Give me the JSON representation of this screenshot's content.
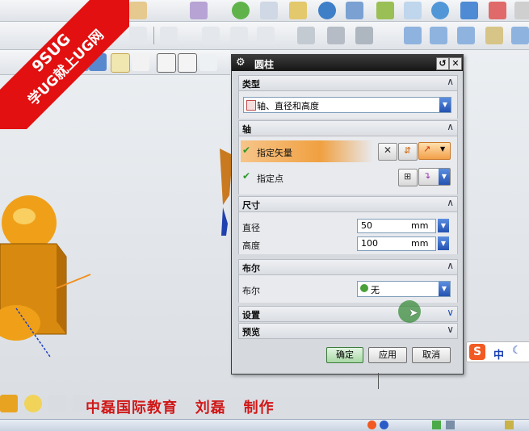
{
  "watermark": {
    "line1": "9SUG",
    "line2": "学UG就上UG网"
  },
  "dialog": {
    "title": "圆柱",
    "sections": {
      "type": {
        "label": "类型",
        "value": "轴、直径和高度"
      },
      "axis": {
        "label": "轴",
        "specify_vector": "指定矢量",
        "specify_point": "指定点"
      },
      "dimensions": {
        "label": "尺寸",
        "diameter_label": "直径",
        "diameter_value": "50",
        "diameter_unit": "mm",
        "height_label": "高度",
        "height_value": "100",
        "height_unit": "mm"
      },
      "boolean": {
        "label": "布尔",
        "field_label": "布尔",
        "value": "无"
      },
      "settings": {
        "label": "设置"
      },
      "preview": {
        "label": "预览"
      }
    },
    "buttons": {
      "ok": "确定",
      "apply": "应用",
      "cancel": "取消"
    }
  },
  "ime": {
    "label": "中"
  },
  "caption": "中磊国际教育   刘磊   制作",
  "colors": {
    "accent_orange": "#f0a040",
    "title_bar": "#1e1e1e",
    "watermark_red": "#e21010",
    "caption_red": "#d01818"
  }
}
